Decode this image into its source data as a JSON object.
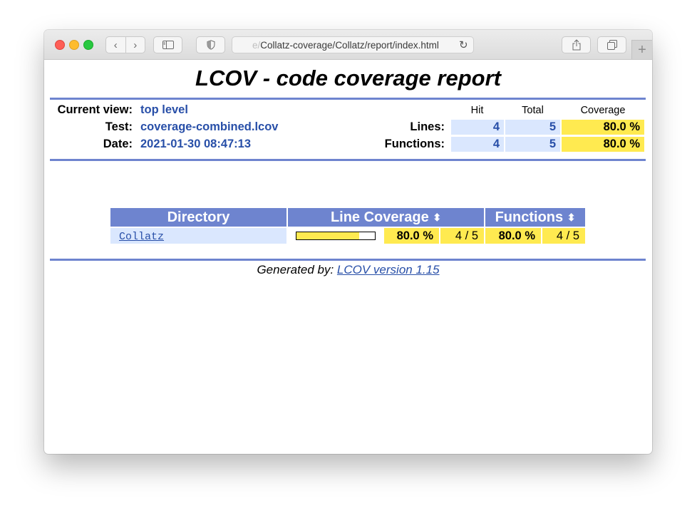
{
  "browser": {
    "url_faded_prefix": "e/",
    "url_text": "Collatz-coverage/Collatz/report/index.html",
    "new_tab_label": "+"
  },
  "report": {
    "title": "LCOV - code coverage report",
    "info": {
      "current_view_label": "Current view:",
      "current_view_value": "top level",
      "test_label": "Test:",
      "test_value": "coverage-combined.lcov",
      "date_label": "Date:",
      "date_value": "2021-01-30 08:47:13"
    },
    "summary": {
      "col_hit": "Hit",
      "col_total": "Total",
      "col_coverage": "Coverage",
      "rows": [
        {
          "label": "Lines:",
          "hit": "4",
          "total": "5",
          "coverage": "80.0 %"
        },
        {
          "label": "Functions:",
          "hit": "4",
          "total": "5",
          "coverage": "80.0 %"
        }
      ]
    },
    "table": {
      "headers": {
        "directory": "Directory",
        "line_coverage": "Line Coverage",
        "functions": "Functions",
        "sort_glyph": "⬍"
      },
      "rows": [
        {
          "directory": "Collatz",
          "line_bar_fraction": 0.8,
          "line_pct": "80.0 %",
          "line_count": "4 / 5",
          "func_pct": "80.0 %",
          "func_count": "4 / 5"
        }
      ]
    },
    "footer": {
      "prefix": "Generated by: ",
      "link": "LCOV version 1.15"
    }
  },
  "colors": {
    "rule": "#6e84cf",
    "header_bg": "#6e84cf",
    "value_blue": "#284fa8",
    "cell_blue": "#dae7fe",
    "coverage_yellow": "#ffea50"
  }
}
